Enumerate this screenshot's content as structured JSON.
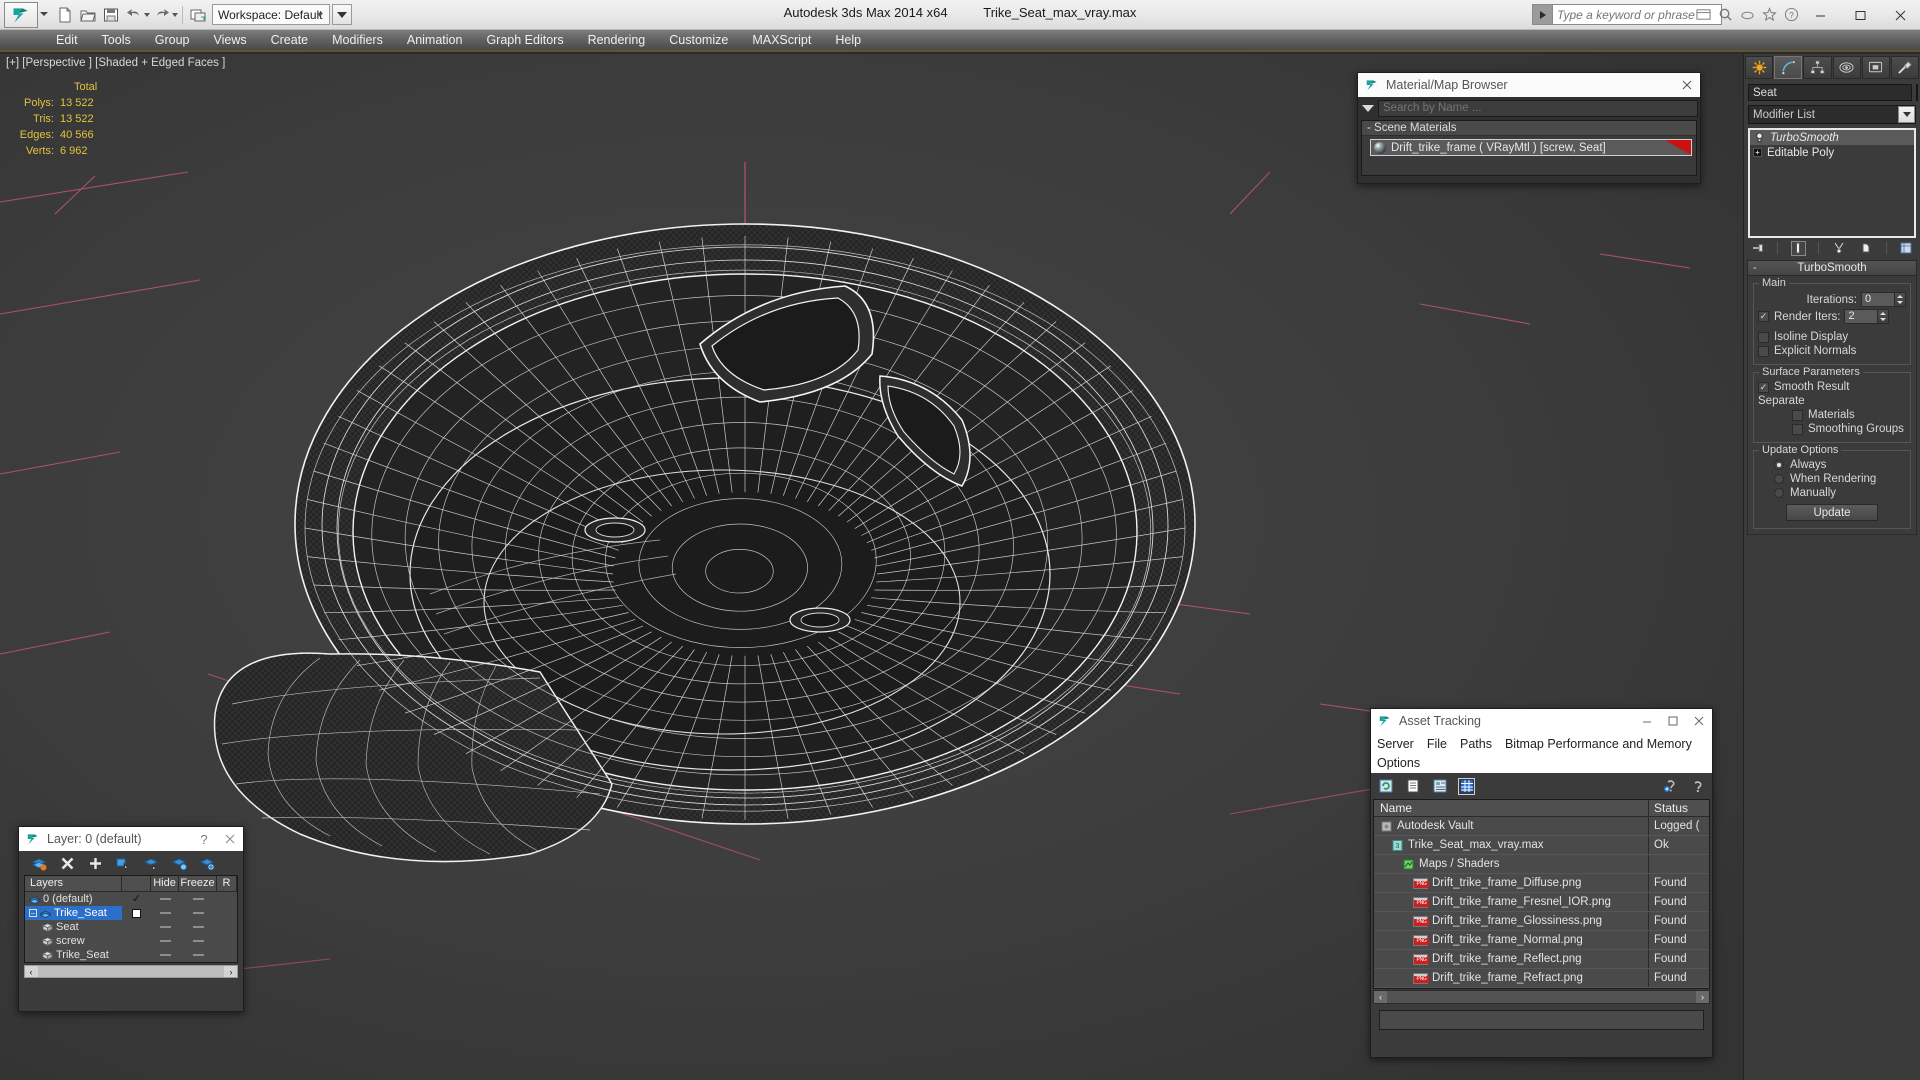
{
  "titlebar": {
    "app_title": "Autodesk 3ds Max  2014 x64",
    "file_title": "Trike_Seat_max_vray.max",
    "workspace": "Workspace: Default",
    "search_placeholder": "Type a keyword or phrase",
    "logo_name": "3ds-max-logo",
    "quick_access": [
      {
        "name": "new-file-icon",
        "label": "New"
      },
      {
        "name": "open-file-icon",
        "label": "Open"
      },
      {
        "name": "save-file-icon",
        "label": "Save"
      },
      {
        "name": "undo-icon",
        "label": "Undo"
      },
      {
        "name": "redo-icon",
        "label": "Redo"
      },
      {
        "name": "project-folder-icon",
        "label": "Set Project Folder"
      }
    ],
    "window_buttons": [
      {
        "name": "minimize-button",
        "glyph": "—"
      },
      {
        "name": "maximize-button",
        "glyph": "□"
      },
      {
        "name": "close-button",
        "glyph": "✕"
      }
    ]
  },
  "menubar": {
    "items": [
      "Edit",
      "Tools",
      "Group",
      "Views",
      "Create",
      "Modifiers",
      "Animation",
      "Graph Editors",
      "Rendering",
      "Customize",
      "MAXScript",
      "Help"
    ]
  },
  "viewport": {
    "label": "[+] [Perspective ] [Shaded + Edged Faces ]",
    "stats_header": "Total",
    "stats": [
      {
        "label": "Polys:",
        "value": "13 522"
      },
      {
        "label": "Tris:",
        "value": "13 522"
      },
      {
        "label": "Edges:",
        "value": "40 566"
      },
      {
        "label": "Verts:",
        "value": "6 962"
      }
    ],
    "stats_color": "#e3c23c",
    "background_color": "#3a3a3a",
    "grid_line_color": "#c25a7a"
  },
  "material_browser": {
    "title": "Material/Map Browser",
    "search_placeholder": "Search by Name ...",
    "group_label": "- Scene Materials",
    "entry": "Drift_trike_frame  ( VRayMtl )  [screw, Seat]",
    "accent_color": "#cc1111",
    "close_label": "✕"
  },
  "command_panel": {
    "tabs": [
      {
        "name": "create-tab",
        "icon": "star-icon",
        "active": false
      },
      {
        "name": "modify-tab",
        "icon": "curve-icon",
        "active": true
      },
      {
        "name": "hierarchy-tab",
        "icon": "hierarchy-icon",
        "active": false
      },
      {
        "name": "motion-tab",
        "icon": "motion-icon",
        "active": false
      },
      {
        "name": "display-tab",
        "icon": "display-icon",
        "active": false
      },
      {
        "name": "utilities-tab",
        "icon": "hammer-icon",
        "active": false
      }
    ],
    "object_name": "Seat",
    "object_color": "#cc55bb",
    "modifier_list_label": "Modifier List",
    "modifier_stack": [
      {
        "label": "TurboSmooth",
        "selected": true,
        "icon": "lightbulb-icon"
      },
      {
        "label": "Editable Poly",
        "selected": false,
        "icon": "plus-box-icon"
      }
    ],
    "stack_tools": [
      {
        "name": "pin-stack-icon"
      },
      {
        "name": "show-end-result-icon",
        "boxed": true
      },
      {
        "name": "make-unique-icon"
      },
      {
        "name": "remove-modifier-icon"
      },
      {
        "name": "configure-modifier-sets-icon"
      }
    ],
    "rollout": {
      "title": "TurboSmooth",
      "collapse_glyph": "-",
      "groups": {
        "main": {
          "title": "Main",
          "iterations_label": "Iterations:",
          "iterations_value": "0",
          "render_iters_label": "Render Iters:",
          "render_iters_value": "2",
          "render_iters_checked": true,
          "isoline_label": "Isoline Display",
          "isoline_checked": false,
          "explicit_label": "Explicit Normals",
          "explicit_checked": false
        },
        "surface": {
          "title": "Surface Parameters",
          "smooth_result_label": "Smooth Result",
          "smooth_result_checked": true,
          "separate_label": "Separate",
          "materials_label": "Materials",
          "materials_checked": false,
          "smoothing_groups_label": "Smoothing Groups",
          "smoothing_groups_checked": false
        },
        "update": {
          "title": "Update Options",
          "options": [
            {
              "label": "Always",
              "selected": true
            },
            {
              "label": "When Rendering",
              "selected": false
            },
            {
              "label": "Manually",
              "selected": false
            }
          ],
          "update_button": "Update"
        }
      }
    }
  },
  "asset_tracking": {
    "title": "Asset Tracking",
    "menu": [
      "Server",
      "File",
      "Paths",
      "Bitmap Performance and Memory",
      "Options"
    ],
    "toolbar": [
      {
        "name": "refresh-icon",
        "selected": false
      },
      {
        "name": "list-view-icon",
        "selected": false
      },
      {
        "name": "detail-view-icon",
        "selected": false
      },
      {
        "name": "grid-view-icon",
        "selected": true
      },
      {
        "name": "help-add-icon",
        "selected": false
      },
      {
        "name": "help-icon",
        "selected": false
      }
    ],
    "columns": [
      "Name",
      "Status"
    ],
    "rows": [
      {
        "name": "Autodesk Vault",
        "status": "Logged (",
        "indent": 0,
        "icon": "vault-icon"
      },
      {
        "name": "Trike_Seat_max_vray.max",
        "status": "Ok",
        "indent": 1,
        "icon": "max-file-icon"
      },
      {
        "name": "Maps / Shaders",
        "status": "",
        "indent": 2,
        "icon": "maps-icon"
      },
      {
        "name": "Drift_trike_frame_Diffuse.png",
        "status": "Found",
        "indent": 3,
        "icon": "png-icon"
      },
      {
        "name": "Drift_trike_frame_Fresnel_IOR.png",
        "status": "Found",
        "indent": 3,
        "icon": "png-icon"
      },
      {
        "name": "Drift_trike_frame_Glossiness.png",
        "status": "Found",
        "indent": 3,
        "icon": "png-icon"
      },
      {
        "name": "Drift_trike_frame_Normal.png",
        "status": "Found",
        "indent": 3,
        "icon": "png-icon"
      },
      {
        "name": "Drift_trike_frame_Reflect.png",
        "status": "Found",
        "indent": 3,
        "icon": "png-icon"
      },
      {
        "name": "Drift_trike_frame_Refract.png",
        "status": "Found",
        "indent": 3,
        "icon": "png-icon"
      }
    ],
    "window_buttons": [
      {
        "name": "minimize-button",
        "glyph": "—"
      },
      {
        "name": "maximize-button",
        "glyph": "□"
      },
      {
        "name": "close-button",
        "glyph": "✕"
      }
    ]
  },
  "layer_dialog": {
    "title": "Layer: 0 (default)",
    "help_glyph": "?",
    "close_glyph": "✕",
    "toolbar": [
      {
        "name": "delete-layer-icon"
      },
      {
        "name": "remove-icon"
      },
      {
        "name": "new-layer-icon"
      },
      {
        "name": "add-selection-to-layer-icon"
      },
      {
        "name": "select-objects-in-layer-icon"
      },
      {
        "name": "set-current-layer-icon"
      },
      {
        "name": "layer-properties-icon"
      }
    ],
    "columns": [
      "Layers",
      "",
      "Hide",
      "Freeze",
      "R"
    ],
    "rows": [
      {
        "name": "0 (default)",
        "type": "layer",
        "indent": 0,
        "current": true,
        "selected": false,
        "hide": "—",
        "freeze": "—"
      },
      {
        "name": "Trike_Seat",
        "type": "layer",
        "indent": 0,
        "current": false,
        "selected": true,
        "hide": "—",
        "freeze": "—"
      },
      {
        "name": "Seat",
        "type": "object",
        "indent": 1,
        "current": false,
        "selected": false,
        "hide": "—",
        "freeze": "—"
      },
      {
        "name": "screw",
        "type": "object",
        "indent": 1,
        "current": false,
        "selected": false,
        "hide": "—",
        "freeze": "—"
      },
      {
        "name": "Trike_Seat",
        "type": "object",
        "indent": 1,
        "current": false,
        "selected": false,
        "hide": "—",
        "freeze": "—"
      }
    ]
  }
}
